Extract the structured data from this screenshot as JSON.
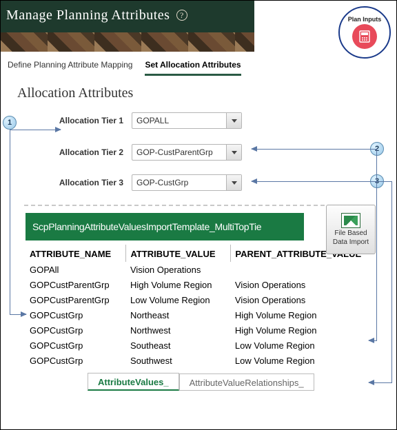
{
  "header": {
    "title": "Manage Planning Attributes",
    "help_icon": "?"
  },
  "plan_inputs": {
    "label": "Plan Inputs"
  },
  "top_tabs": {
    "define": "Define Planning Attribute Mapping",
    "set": "Set Allocation Attributes"
  },
  "section_title": "Allocation Attributes",
  "tiers": [
    {
      "label": "Allocation Tier 1",
      "value": "GOPALL"
    },
    {
      "label": "Allocation Tier 2",
      "value": "GOP-CustParentGrp"
    },
    {
      "label": "Allocation Tier 3",
      "value": "GOP-CustGrp"
    }
  ],
  "callouts": {
    "c1": "1",
    "c2": "2",
    "c3": "3"
  },
  "excel_banner": "ScpPlanningAttributeValuesImportTemplate_MultiTopTie",
  "fbdi": {
    "line1": "File Based",
    "line2": "Data Import"
  },
  "table": {
    "headers": {
      "attr_name": "ATTRIBUTE_NAME",
      "attr_value": "ATTRIBUTE_VALUE",
      "parent_value": "PARENT_ATTRIBUTE_VALUE"
    },
    "rows": [
      {
        "name": "GOPAll",
        "value": "Vision Operations",
        "parent": ""
      },
      {
        "name": "GOPCustParentGrp",
        "value": "High Volume Region",
        "parent": "Vision Operations"
      },
      {
        "name": "GOPCustParentGrp",
        "value": "Low Volume Region",
        "parent": "Vision Operations"
      },
      {
        "name": "GOPCustGrp",
        "value": "Northeast",
        "parent": "High Volume Region"
      },
      {
        "name": "GOPCustGrp",
        "value": "Northwest",
        "parent": "High Volume Region"
      },
      {
        "name": "GOPCustGrp",
        "value": "Southeast",
        "parent": "Low Volume Region"
      },
      {
        "name": "GOPCustGrp",
        "value": "Southwest",
        "parent": "Low Volume Region"
      }
    ]
  },
  "sheet_tabs": {
    "values": "AttributeValues_",
    "rels": "AttributeValueRelationships_"
  }
}
